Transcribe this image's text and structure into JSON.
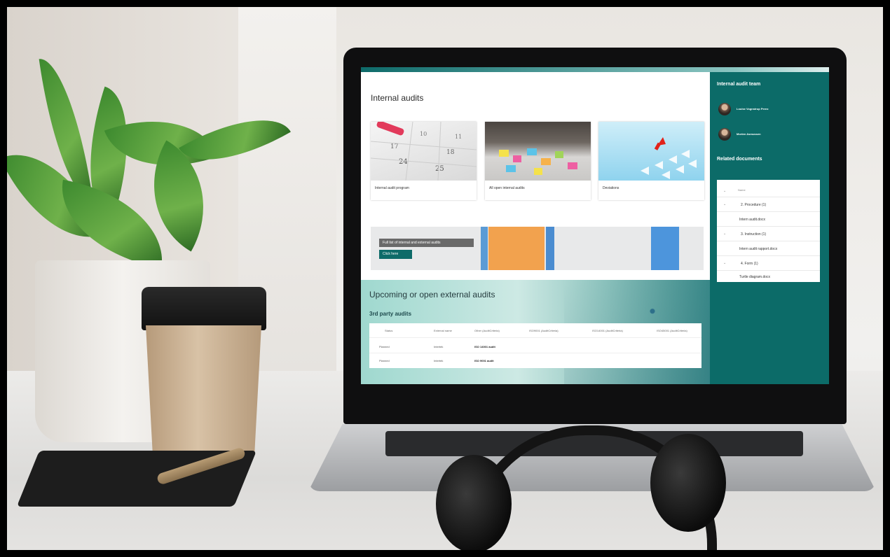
{
  "page": {
    "title": "Internal audits"
  },
  "cards": [
    {
      "label": "Internal audit program"
    },
    {
      "label": "All open internal audits"
    },
    {
      "label": "Deviations"
    }
  ],
  "banner": {
    "caption": "Full list of internal and external audits",
    "button": "Click here"
  },
  "upcoming": {
    "title": "Upcoming or open external audits",
    "subtitle": "3rd party audits",
    "columns": [
      "Status",
      "External name",
      "Other (AuditCriteria)",
      "ISO9001 (AuditCriteria)",
      "ISO14001 (AuditCriteria)",
      "ISO45001 (AuditCriteria)"
    ],
    "rows": [
      {
        "status": "Planned",
        "external": "Intertek",
        "other": "ISO 14001 audit"
      },
      {
        "status": "Planned",
        "external": "Intertek",
        "other": "ISO 9001 audit"
      }
    ]
  },
  "sidebar": {
    "team_title": "Internal audit team",
    "team": [
      {
        "name": "Louise Vognstrup Perez"
      },
      {
        "name": "Morten Asmussen"
      }
    ],
    "docs_title": "Related documents",
    "docs_header": "Name",
    "docs": [
      {
        "label": "2. Procedure (1)",
        "group": true
      },
      {
        "label": "Intern audit.docx",
        "group": false
      },
      {
        "label": "3. Instruction (1)",
        "group": true
      },
      {
        "label": "Intern audit rapport.docx",
        "group": false
      },
      {
        "label": "4. Form (1)",
        "group": true
      },
      {
        "label": "Turtle diagram.docx",
        "group": false
      }
    ]
  },
  "colors": {
    "accent": "#0c6b68",
    "button": "#0e6b69",
    "banner_orange": "#f2a24e"
  }
}
